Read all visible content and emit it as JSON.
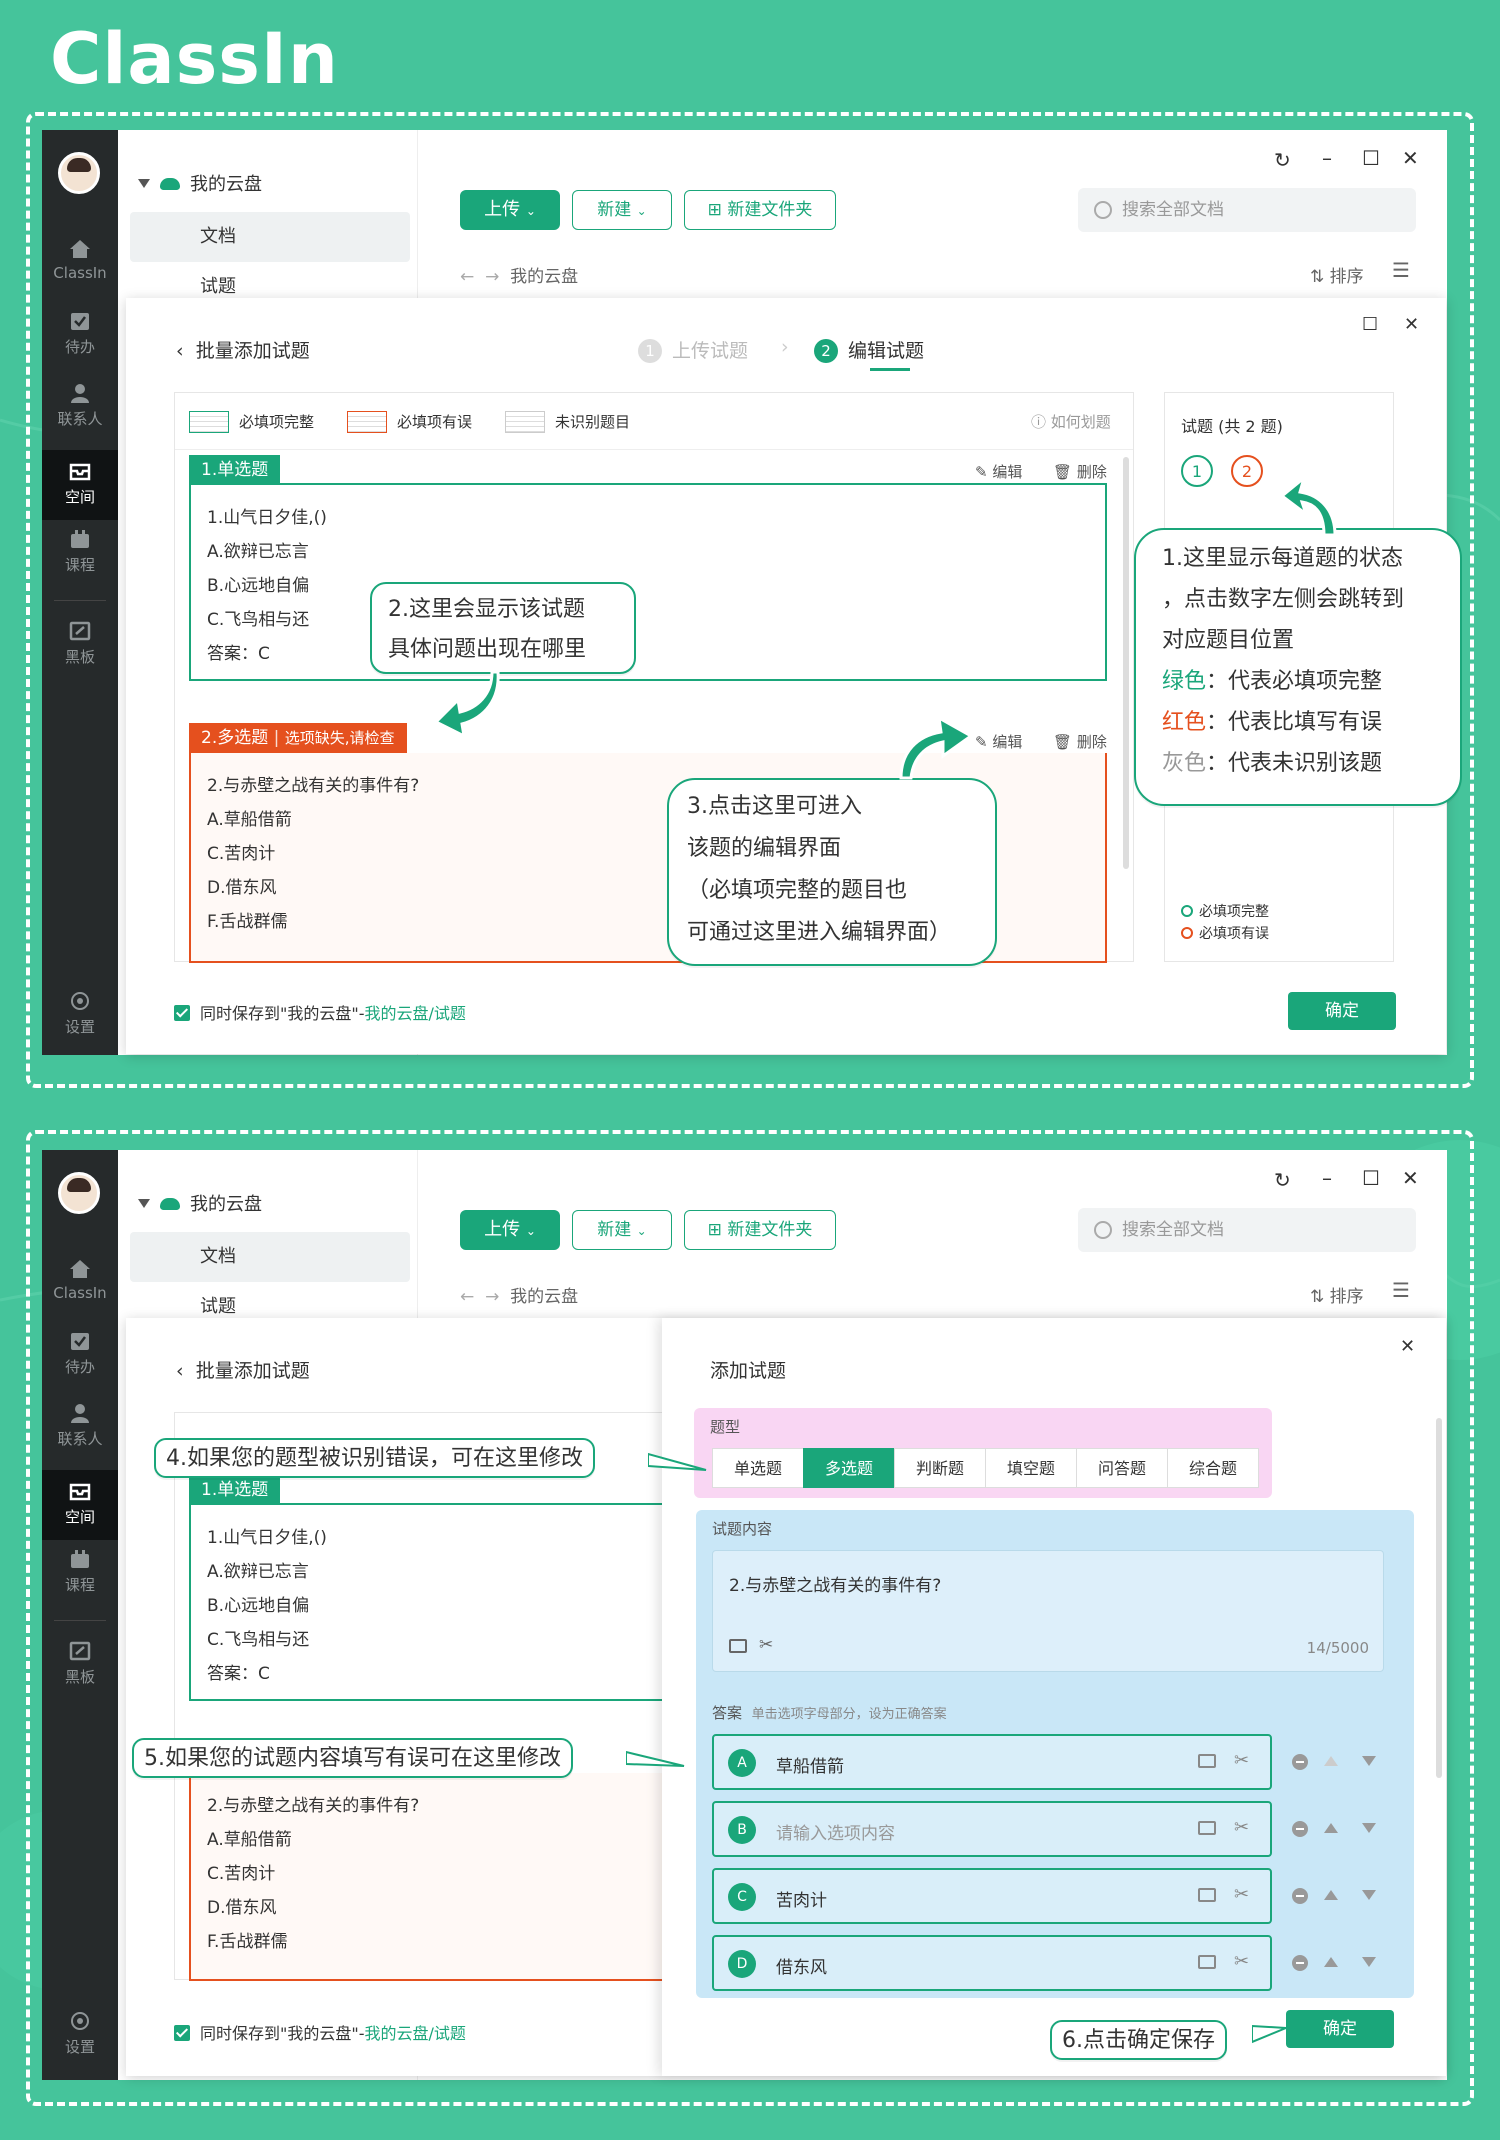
{
  "brand": "ClassIn",
  "sidebar": {
    "items": [
      {
        "label": "ClassIn"
      },
      {
        "label": "待办"
      },
      {
        "label": "联系人"
      },
      {
        "label": "空间"
      },
      {
        "label": "课程"
      },
      {
        "label": "黑板"
      }
    ],
    "settings_label": "设置"
  },
  "tree": {
    "root": "我的云盘",
    "items": [
      "文档",
      "试题"
    ]
  },
  "toolbar": {
    "upload": "上传",
    "new": "新建",
    "new_folder": "新建文件夹",
    "search_placeholder": "搜索全部文档",
    "sort": "排序"
  },
  "breadcrumb": {
    "current": "我的云盘"
  },
  "modal": {
    "title": "批量添加试题",
    "step1": "上传试题",
    "step1_num": "1",
    "step2": "编辑试题",
    "step2_num": "2",
    "legend": {
      "complete": "必填项完整",
      "error": "必填项有误",
      "unrecognized": "未识别题目",
      "help": "如何划题"
    },
    "q1": {
      "header": "1.单选题",
      "lines": [
        "1.山气日夕佳,()",
        "A.欲辩已忘言",
        "B.心远地自偏",
        "C.飞鸟相与还",
        "答案：C"
      ]
    },
    "q2": {
      "header": "2.多选题",
      "warning": "选项缺失,请检查",
      "lines": [
        "2.与赤壁之战有关的事件有?",
        "A.草船借箭",
        "C.苦肉计",
        "D.借东风",
        "F.舌战群儒"
      ]
    },
    "edit": "编辑",
    "delete": "删除",
    "nav_title": "试题 (共 2 题)",
    "nav_nums": [
      "1",
      "2"
    ],
    "nav_legend": {
      "complete": "必填项完整",
      "error": "必填项有误"
    },
    "save_to": "同时保存到\"我的云盘\"-",
    "save_path": "我的云盘/试题",
    "confirm": "确定"
  },
  "callouts": {
    "c1": [
      "1.这里显示每道题的状态",
      "，点击数字左侧会跳转到",
      "对应题目位置"
    ],
    "c1_green_key": "绿色",
    "c1_green": "：代表必填项完整",
    "c1_red_key": "红色",
    "c1_red": "：代表比填写有误",
    "c1_gray_key": "灰色",
    "c1_gray": "：代表未识别该题",
    "c2": [
      "2.这里会显示该试题",
      "具体问题出现在哪里"
    ],
    "c3": [
      "3.点击这里可进入",
      "该题的编辑界面",
      "（必填项完整的题目也",
      "可通过这里进入编辑界面）"
    ],
    "c4": "4.如果您的题型被识别错误，可在这里修改",
    "c5": "5.如果您的试题内容填写有误可在这里修改",
    "c6": "6.点击确定保存"
  },
  "drawer": {
    "title": "添加试题",
    "type_label": "题型",
    "types": [
      "单选题",
      "多选题",
      "判断题",
      "填空题",
      "问答题",
      "综合题"
    ],
    "selected_type": "多选题",
    "content_label": "试题内容",
    "content": "2.与赤壁之战有关的事件有?",
    "counter": "14/5000",
    "answer_label": "答案",
    "answer_hint": "单击选项字母部分，设为正确答案",
    "options": [
      {
        "letter": "A",
        "text": "草船借箭"
      },
      {
        "letter": "B",
        "text": "",
        "placeholder": "请输入选项内容"
      },
      {
        "letter": "C",
        "text": "苦肉计"
      },
      {
        "letter": "D",
        "text": "借东风"
      }
    ]
  },
  "colors": {
    "brand_green": "#1aa67a",
    "error_red": "#e5501e",
    "bg_green": "#45c49b",
    "drawer_blue": "#c9e7f7",
    "type_pink": "#f9d6f3"
  }
}
